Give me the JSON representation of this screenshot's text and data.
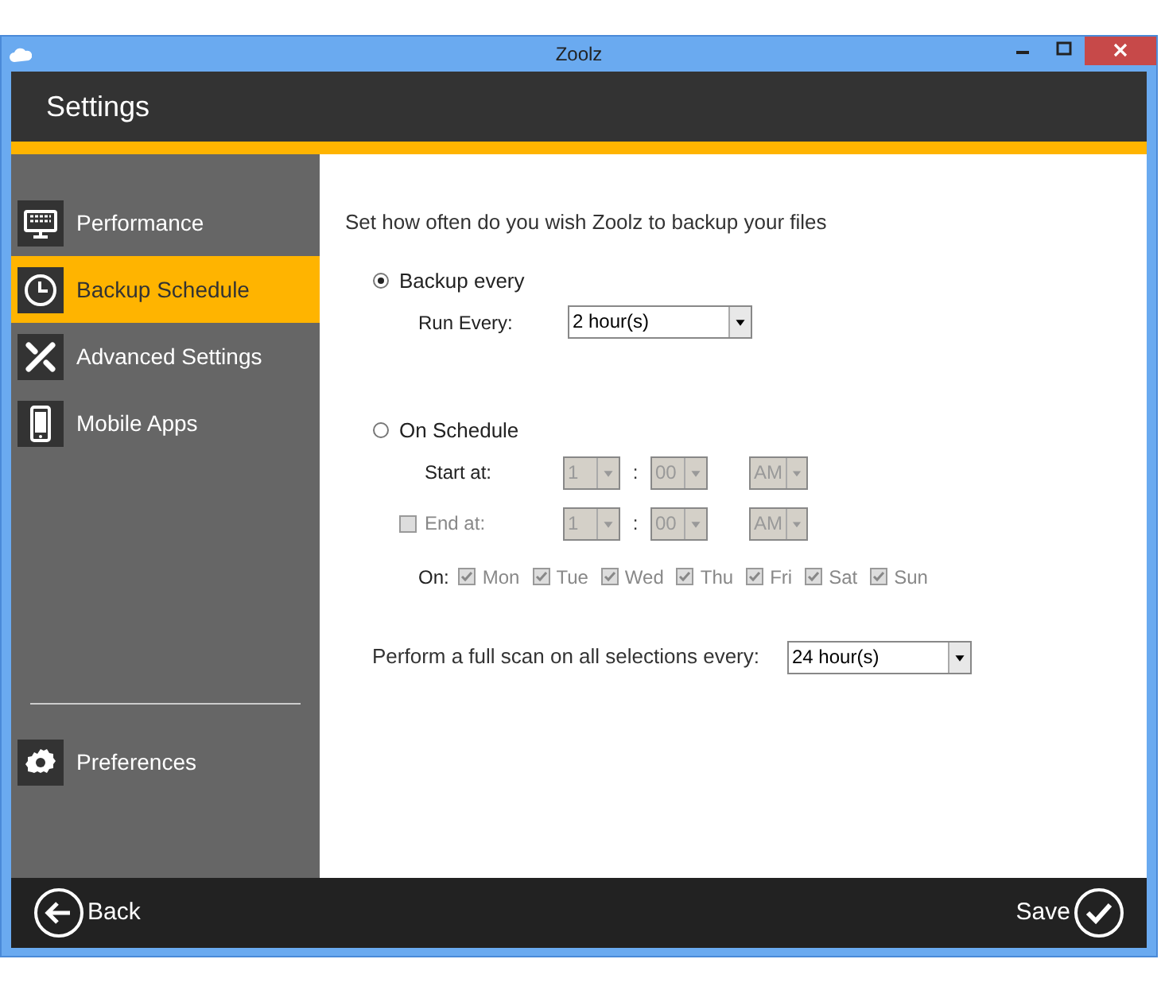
{
  "window": {
    "title": "Zoolz"
  },
  "header": {
    "title": "Settings"
  },
  "sidebar": {
    "items": [
      {
        "label": "Performance",
        "kind": "keyboard",
        "selected": false
      },
      {
        "label": "Backup Schedule",
        "kind": "clock",
        "selected": true
      },
      {
        "label": "Advanced Settings",
        "kind": "tools",
        "selected": false
      },
      {
        "label": "Mobile Apps",
        "kind": "phone",
        "selected": false
      }
    ],
    "bottom_items": [
      {
        "label": "Preferences",
        "kind": "gear",
        "selected": false
      }
    ]
  },
  "content": {
    "heading": "Set how often do you wish Zoolz to backup your files",
    "backup_every": {
      "label": "Backup every",
      "selected": true,
      "run_every": {
        "label": "Run Every:",
        "value": "2 hour(s)"
      }
    },
    "on_schedule": {
      "label": "On Schedule",
      "selected": false,
      "start_at": {
        "label": "Start at:",
        "hour": "1",
        "separator": ":",
        "minute": "00",
        "ampm": "AM"
      },
      "end_at": {
        "label": "End at:",
        "checked": false,
        "hour": "1",
        "separator": ":",
        "minute": "00",
        "ampm": "AM"
      },
      "days": {
        "label": "On:",
        "items": [
          {
            "label": "Mon",
            "checked": true
          },
          {
            "label": "Tue",
            "checked": true
          },
          {
            "label": "Wed",
            "checked": true
          },
          {
            "label": "Thu",
            "checked": true
          },
          {
            "label": "Fri",
            "checked": true
          },
          {
            "label": "Sat",
            "checked": true
          },
          {
            "label": "Sun",
            "checked": true
          }
        ]
      }
    },
    "full_scan": {
      "label": "Perform a full scan on all selections every:",
      "value": "24 hour(s)"
    }
  },
  "footer": {
    "back": "Back",
    "save": "Save"
  }
}
